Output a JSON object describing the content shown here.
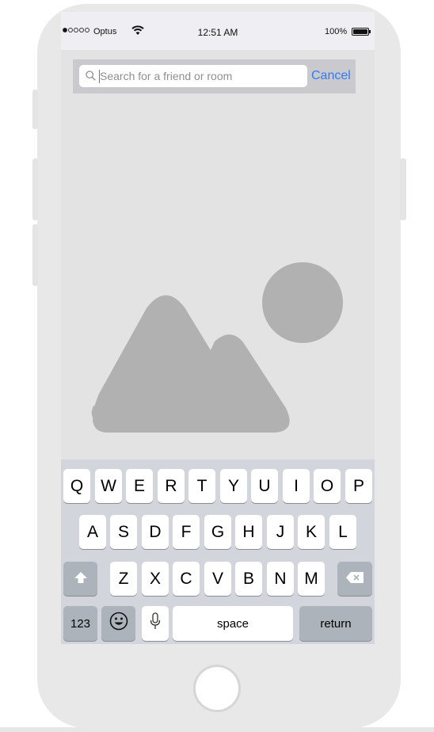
{
  "status_bar": {
    "carrier": "Optus",
    "time": "12:51 AM",
    "battery_percent": "100%",
    "signal_bars_filled": 1,
    "signal_bars_total": 5
  },
  "search": {
    "placeholder": "Search for a friend or room",
    "value": "",
    "cancel_label": "Cancel"
  },
  "main": {
    "image_placeholder_icon": "image-placeholder-icon"
  },
  "keyboard": {
    "row1": [
      "Q",
      "W",
      "E",
      "R",
      "T",
      "Y",
      "U",
      "I",
      "O",
      "P"
    ],
    "row2": [
      "A",
      "S",
      "D",
      "F",
      "G",
      "H",
      "J",
      "K",
      "L"
    ],
    "row3": [
      "Z",
      "X",
      "C",
      "V",
      "B",
      "N",
      "M"
    ],
    "numbers_label": "123",
    "space_label": "space",
    "return_label": "return",
    "shift_icon": "shift-icon",
    "backspace_icon": "backspace-icon",
    "emoji_icon": "emoji-icon",
    "mic_icon": "microphone-icon"
  },
  "colors": {
    "accent": "#2f7cf6",
    "keyboard_bg": "#d2d5db",
    "dark_key": "#acb3bb",
    "placeholder_shape": "#b1b1b1"
  }
}
